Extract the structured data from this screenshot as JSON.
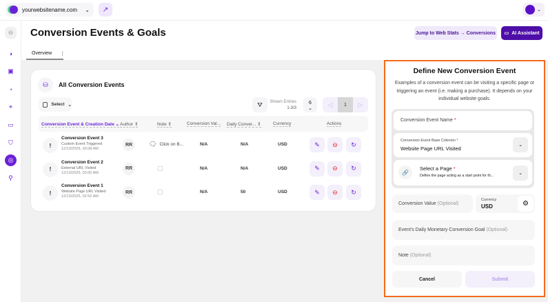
{
  "topbar": {
    "site": "yourwebsitename.com",
    "site_icon": "globe-icon",
    "external_icon": "external-link-icon",
    "avatar_color": "#5b0fc6"
  },
  "sidebar": {
    "items": [
      "collapse",
      "analytics",
      "bag",
      "pulse",
      "scan",
      "chat",
      "shield",
      "goals",
      "location"
    ],
    "active": "goals"
  },
  "header": {
    "title": "Conversion Events & Goals",
    "jump_label": "Jump to Web Stats → Conversions",
    "ai_label": "AI Assistant"
  },
  "tabs": [
    {
      "label": "Overview"
    }
  ],
  "card": {
    "title": "All Conversion Events",
    "select_label": "Select",
    "shown_label": "Shown Entries",
    "shown_value": "1-3/3",
    "per_page": "6",
    "page": "1",
    "columns": [
      "Conversion Event & Creation Date",
      "Author",
      "Note",
      "Conversion Val...",
      "Daily Conver...",
      "Currency",
      "Actions"
    ],
    "rows": [
      {
        "name": "Conversion Event 3",
        "type": "Custom Event Triggered",
        "date": "12/13/2025, 03:08 AM",
        "author": "RR",
        "note": "Click on B...",
        "value": "N/A",
        "daily": "N/A",
        "currency": "USD"
      },
      {
        "name": "Conversion Event 2",
        "type": "External URL Visited",
        "date": "12/13/2025, 03:00 AM",
        "author": "RR",
        "note": "",
        "value": "N/A",
        "daily": "N/A",
        "currency": "USD"
      },
      {
        "name": "Conversion Event 1",
        "type": "Website Page URL Visited",
        "date": "12/13/2025, 02:52 AM",
        "author": "RR",
        "note": "",
        "value": "N/A",
        "daily": "50",
        "currency": "USD"
      }
    ]
  },
  "panel": {
    "title": "Define New Conversion Event",
    "description": "Examples of a conversion event can be visiting a specific page or triggering an event (i.e. making a purchase). It depends on your individual website goals.",
    "name_label": "Conversion Event Name",
    "criterion_label": "Conversion Event Base Criterion",
    "criterion_value": "Website Page URL Visited",
    "page_label": "Select a Page",
    "page_hint": "Define the page acting as a start point for th...",
    "value_label": "Conversion Value",
    "optional": "(Optional)",
    "currency_label": "Currency",
    "currency_value": "USD",
    "goal_label": "Event's Daily Monetary Conversion Goal",
    "note_label": "Note",
    "cancel": "Cancel",
    "submit": "Submit",
    "accent": "#f26a1b"
  }
}
